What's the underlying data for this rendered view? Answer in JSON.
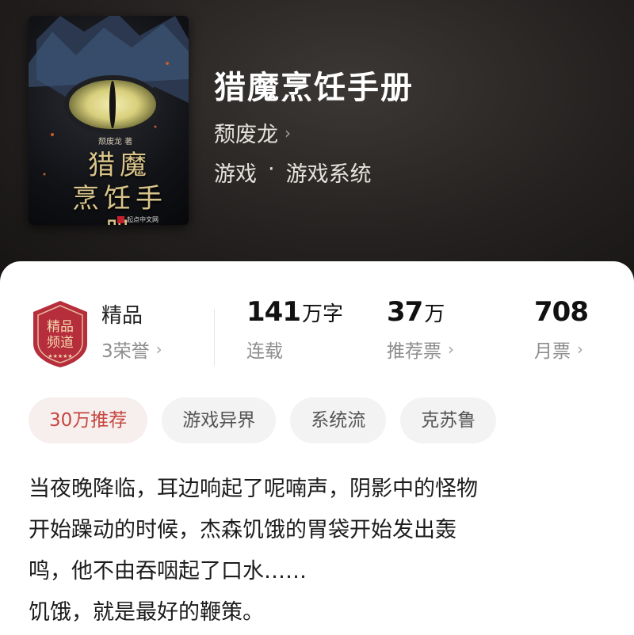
{
  "book": {
    "title": "猎魔烹饪手册",
    "author": "颓废龙",
    "author_chevron": "›",
    "genre": "游戏",
    "genre_sep": "·",
    "subgenre": "游戏系统"
  },
  "cover": {
    "title_line1": "猎魔",
    "title_line2": "烹饪手册",
    "author": "颓废龙 著",
    "publisher": "起点中文网"
  },
  "stats": {
    "rank": {
      "label": "精品",
      "honors": "3荣誉",
      "badge_text_1": "精品",
      "badge_text_2": "频道"
    },
    "words": {
      "value": "141",
      "unit": "万字",
      "label": "连载"
    },
    "recommend": {
      "value": "37",
      "unit": "万",
      "label": "推荐票"
    },
    "monthly": {
      "value": "708",
      "label": "月票"
    },
    "chevron": "›"
  },
  "tags": [
    "30万推荐",
    "游戏异界",
    "系统流",
    "克苏鲁"
  ],
  "description": {
    "line1": "当夜晚降临，耳边响起了呢喃声，阴影中的怪物",
    "line2": "开始躁动的时候，杰森饥饿的胃袋开始发出轰",
    "line3": "鸣，他不由吞咽起了口水……",
    "line4": "饥饿，就是最好的鞭策。"
  },
  "colors": {
    "accent": "#c5473e",
    "badge": "#b62d3b",
    "hero_bg": "#242120"
  }
}
